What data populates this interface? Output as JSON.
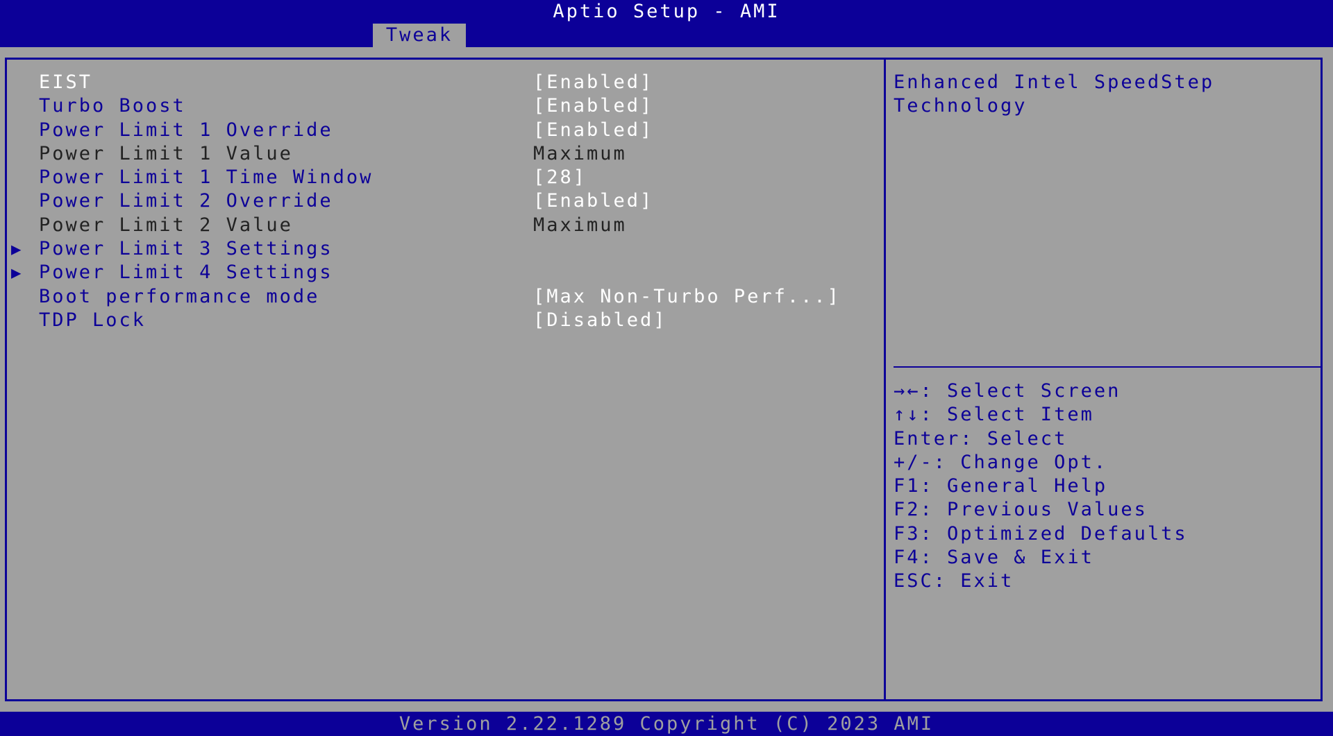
{
  "header": {
    "title": "Aptio Setup - AMI",
    "active_tab": "Tweak"
  },
  "menu": {
    "items": [
      {
        "label": "EIST",
        "value": "[Enabled]"
      },
      {
        "label": "Turbo Boost",
        "value": "[Enabled]"
      },
      {
        "label": "Power Limit 1 Override",
        "value": "[Enabled]"
      },
      {
        "label": "Power Limit 1 Value",
        "value": "Maximum"
      },
      {
        "label": "Power Limit 1 Time Window",
        "value": "[28]"
      },
      {
        "label": "Power Limit 2 Override",
        "value": "[Enabled]"
      },
      {
        "label": "Power Limit 2 Value",
        "value": "Maximum"
      },
      {
        "label": "Power Limit 3 Settings",
        "value": ""
      },
      {
        "label": "Power Limit 4 Settings",
        "value": ""
      },
      {
        "label": "Boot performance mode",
        "value": "[Max Non-Turbo Perf...]"
      },
      {
        "label": "TDP Lock",
        "value": "[Disabled]"
      }
    ]
  },
  "help": {
    "text": "Enhanced Intel SpeedStep Technology"
  },
  "keys": [
    "→←: Select Screen",
    "↑↓: Select Item",
    "Enter: Select",
    "+/-: Change Opt.",
    "F1: General Help",
    "F2: Previous Values",
    "F3: Optimized Defaults",
    "F4: Save & Exit",
    "ESC: Exit"
  ],
  "footer": {
    "text": "Version 2.22.1289 Copyright (C) 2023 AMI"
  },
  "colors": {
    "background_blue": "#0c0098",
    "panel_gray": "#a0a0a0",
    "selected_text": "#ffffff",
    "static_text": "#222222"
  },
  "icons": {
    "submenu": "submenu-arrow-icon"
  }
}
